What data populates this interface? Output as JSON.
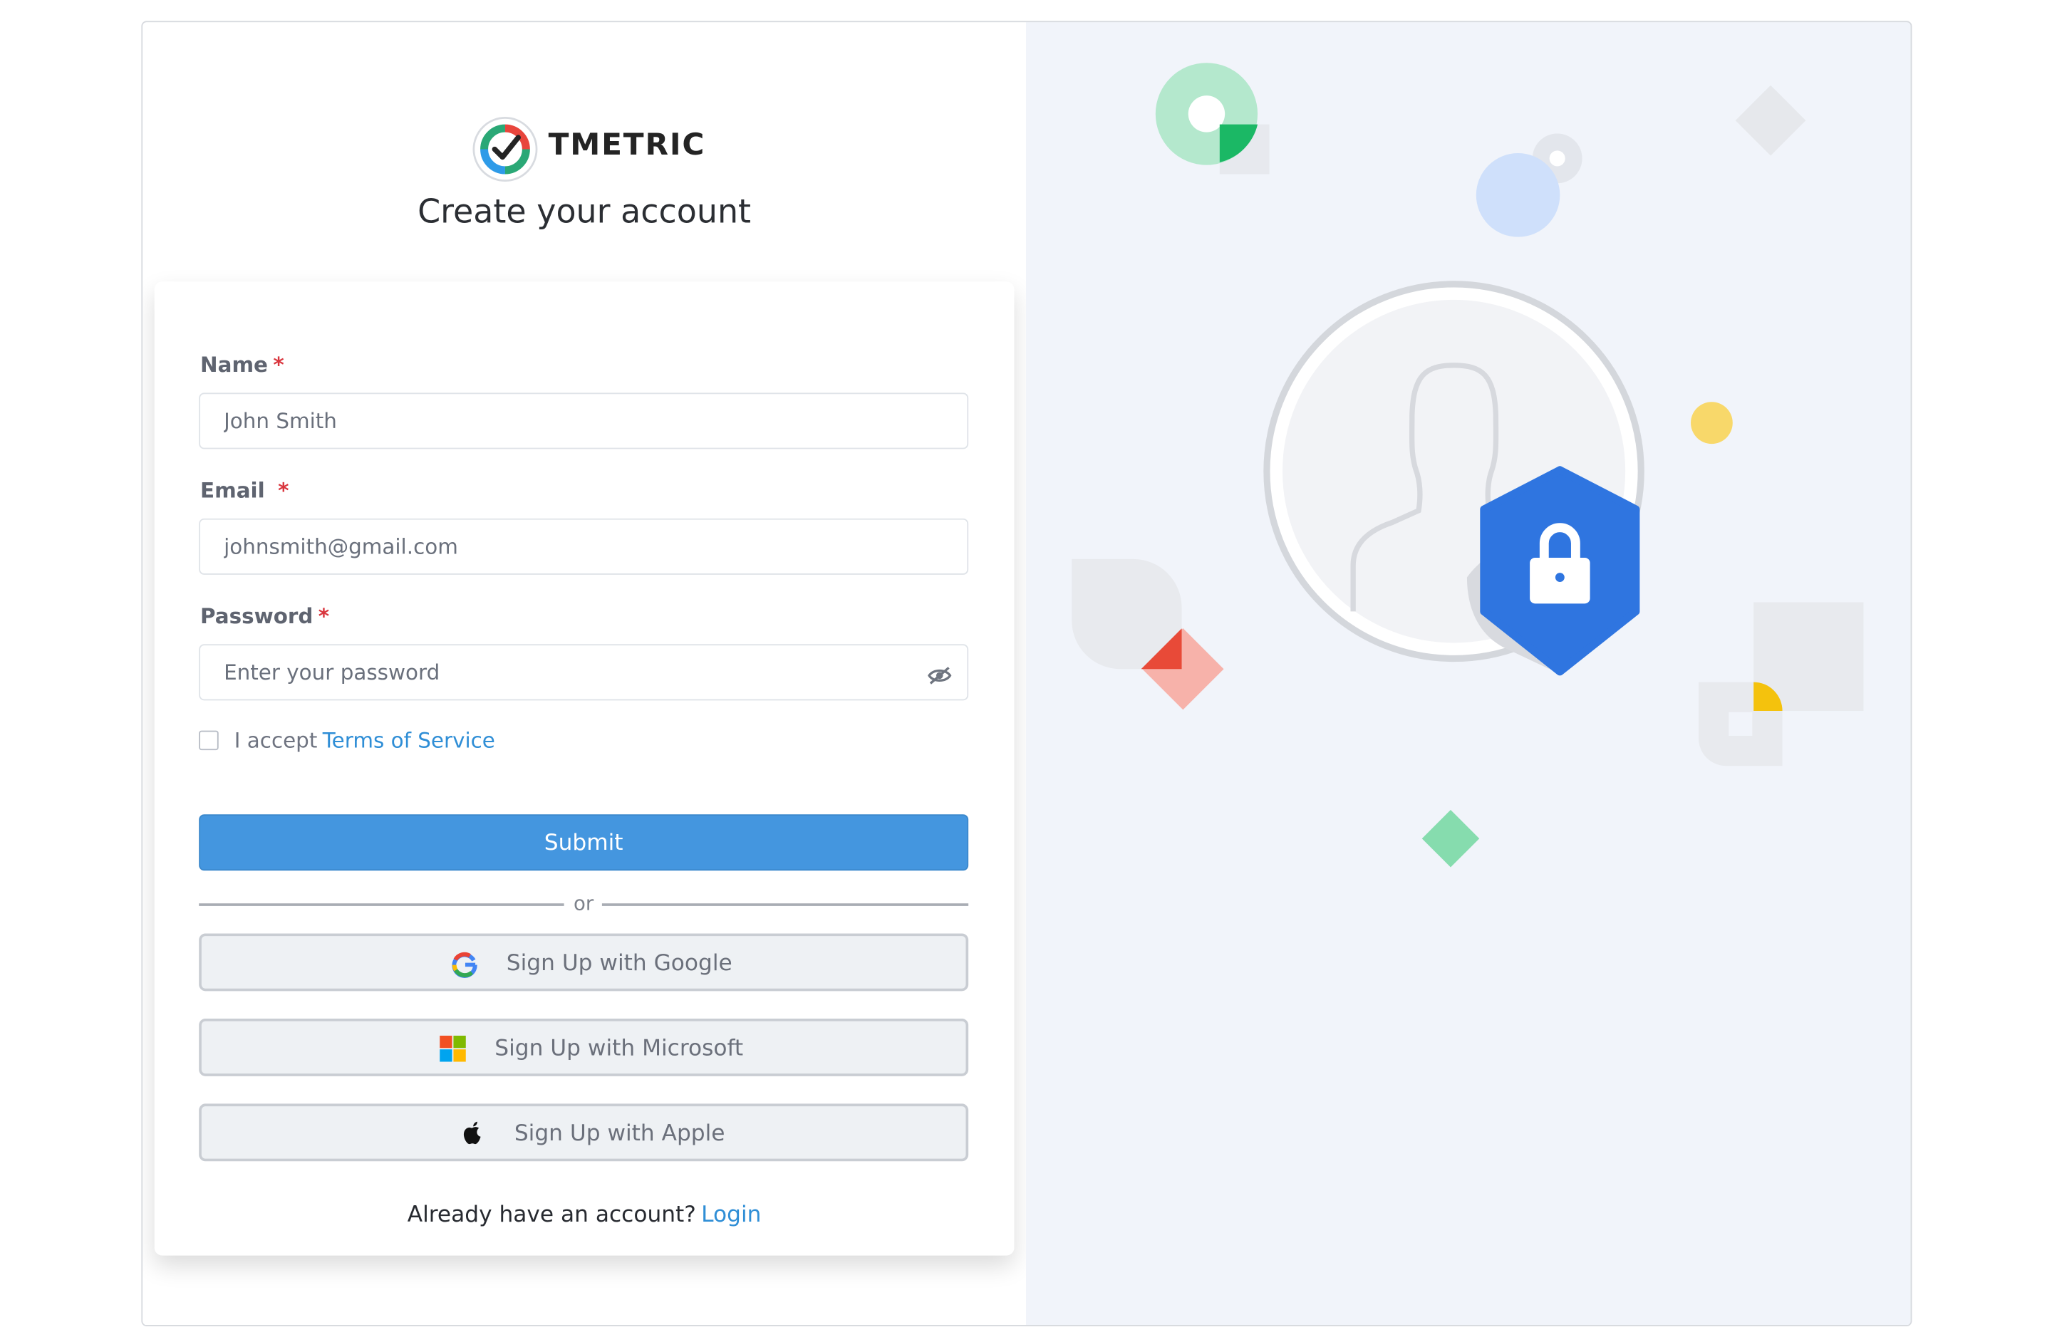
{
  "brand": {
    "name": "TMETRIC"
  },
  "header": {
    "title": "Create your account"
  },
  "form": {
    "name": {
      "label": "Name",
      "required_mark": "*",
      "placeholder": "John Smith"
    },
    "email": {
      "label": "Email",
      "required_mark": "*",
      "placeholder": "johnsmith@gmail.com"
    },
    "password": {
      "label": "Password",
      "required_mark": "*",
      "placeholder": "Enter your password",
      "visibility_icon": "eye-slash-icon"
    },
    "terms": {
      "prefix": "I accept",
      "link_label": "Terms of Service",
      "checked": false
    },
    "submit_label": "Submit",
    "divider_label": "or"
  },
  "social": [
    {
      "label": "Sign Up with Google",
      "icon": "google-icon"
    },
    {
      "label": "Sign Up with Microsoft",
      "icon": "microsoft-icon"
    },
    {
      "label": "Sign Up with Apple",
      "icon": "apple-icon"
    }
  ],
  "footer": {
    "prompt": "Already have an account?",
    "login_label": "Login"
  },
  "colors": {
    "primary": "#4496df",
    "link": "#2f8ed6",
    "required": "#d9363e",
    "panel_background": "#f1f4fa",
    "shield": "#2f75e0"
  }
}
